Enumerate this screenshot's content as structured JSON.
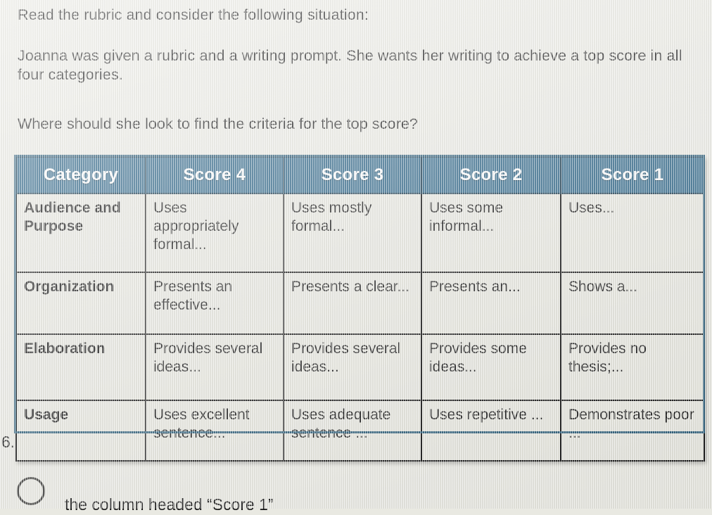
{
  "prompt": {
    "line1": "Read the rubric and consider the following situation:",
    "line2": "Joanna was given a rubric and a writing prompt. She wants her writing to achieve a top score in all four categories.",
    "line3": "Where should she look to find the criteria for the top score?"
  },
  "rubric": {
    "headers": [
      "Category",
      "Score 4",
      "Score 3",
      "Score 2",
      "Score 1"
    ],
    "header_bg": "#2e6688",
    "header_text_color": "#ffffff",
    "cell_bg": "#e6e6de",
    "rows": [
      {
        "category": "Audience and Purpose",
        "score4": "Uses appropriately formal...",
        "score3": "Uses mostly formal...",
        "score2": "Uses some informal...",
        "score1": "Uses..."
      },
      {
        "category": "Organization",
        "score4": "Presents an effective...",
        "score3": "Presents a clear...",
        "score2": "Presents an...",
        "score1": "Shows a..."
      },
      {
        "category": "Elaboration",
        "score4": "Provides several ideas...",
        "score3": "Provides several ideas...",
        "score2": "Provides some ideas...",
        "score1": "Provides no thesis;..."
      },
      {
        "category": "Usage",
        "score4": "Uses excellent sentence...",
        "score3": "Uses adequate sentence ...",
        "score2": "Uses repetitive ...",
        "score1": "Demonstrates poor ..."
      }
    ]
  },
  "question": {
    "number": "6.",
    "options": [
      {
        "label": "the column headed “Score 1”",
        "selected": false
      }
    ]
  }
}
